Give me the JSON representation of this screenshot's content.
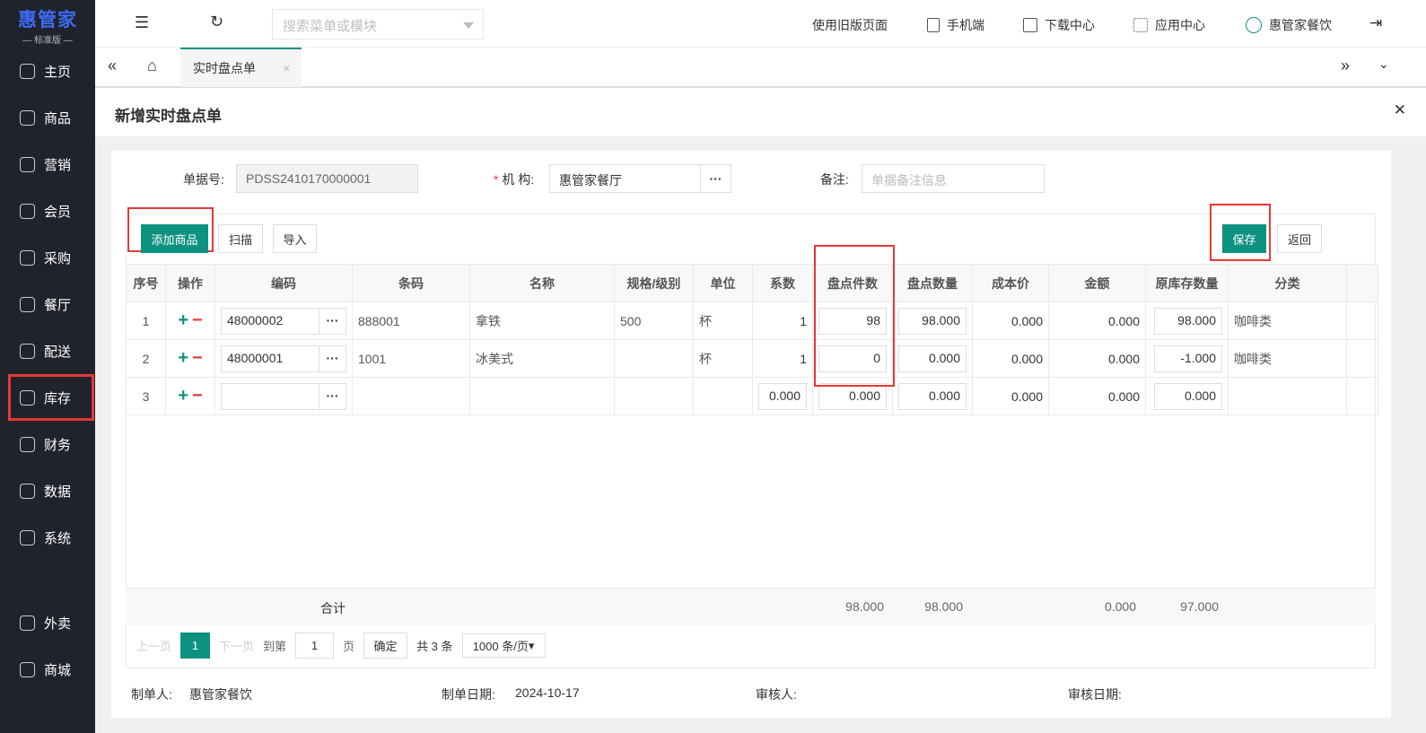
{
  "logo": {
    "title": "惠管家",
    "edition": "— 标准版 —"
  },
  "sidebar": [
    "主页",
    "商品",
    "营销",
    "会员",
    "采购",
    "餐厅",
    "配送",
    "库存",
    "财务",
    "数据",
    "系统",
    "外卖",
    "商城"
  ],
  "topbar": {
    "search_placeholder": "搜索菜单或模块",
    "old_page": "使用旧版页面",
    "mobile": "手机端",
    "download": "下载中心",
    "apps": "应用中心",
    "user": "惠管家餐饮"
  },
  "tabs": {
    "active": "实时盘点单",
    "close": "×"
  },
  "page": {
    "title": "新增实时盘点单",
    "close": "✕"
  },
  "form": {
    "doc_no_label": "单据号:",
    "doc_no": "PDSS2410170000001",
    "org_label": "机 构:",
    "org": "惠管家餐厅",
    "remark_label": "备注:",
    "remark_placeholder": "单据备注信息"
  },
  "toolbar": {
    "add": "添加商品",
    "scan": "扫描",
    "import": "导入",
    "save": "保存",
    "back": "返回"
  },
  "table": {
    "headers": [
      "序号",
      "操作",
      "编码",
      "条码",
      "名称",
      "规格/级别",
      "单位",
      "系数",
      "盘点件数",
      "盘点数量",
      "成本价",
      "金额",
      "原库存数量",
      "分类"
    ],
    "rows": [
      {
        "no": "1",
        "code": "48000002",
        "barcode": "888001",
        "name": "拿铁",
        "spec": "500",
        "unit": "杯",
        "factor": "1",
        "count": "98",
        "qty": "98.000",
        "cost": "0.000",
        "amount": "0.000",
        "stock": "98.000",
        "cat": "咖啡类"
      },
      {
        "no": "2",
        "code": "48000001",
        "barcode": "1001",
        "name": "冰美式",
        "spec": "",
        "unit": "杯",
        "factor": "1",
        "count": "0",
        "qty": "0.000",
        "cost": "0.000",
        "amount": "0.000",
        "stock": "-1.000",
        "cat": "咖啡类"
      },
      {
        "no": "3",
        "code": "",
        "barcode": "",
        "name": "",
        "spec": "",
        "unit": "",
        "factor": "0.000",
        "count": "0.000",
        "qty": "0.000",
        "cost": "0.000",
        "amount": "0.000",
        "stock": "0.000",
        "cat": ""
      }
    ],
    "total": {
      "label": "合计",
      "count": "98.000",
      "qty": "98.000",
      "amount": "0.000",
      "stock": "97.000"
    }
  },
  "pager": {
    "prev": "上一页",
    "page": "1",
    "next": "下一页",
    "goto": "到第",
    "goto_val": "1",
    "page_unit": "页",
    "confirm": "确定",
    "total": "共 3 条",
    "size": "1000 条/页"
  },
  "footer": {
    "maker_label": "制单人:",
    "maker": "惠管家餐饮",
    "date_label": "制单日期:",
    "date": "2024-10-17",
    "auditor_label": "审核人:",
    "audit_date_label": "审核日期:"
  }
}
